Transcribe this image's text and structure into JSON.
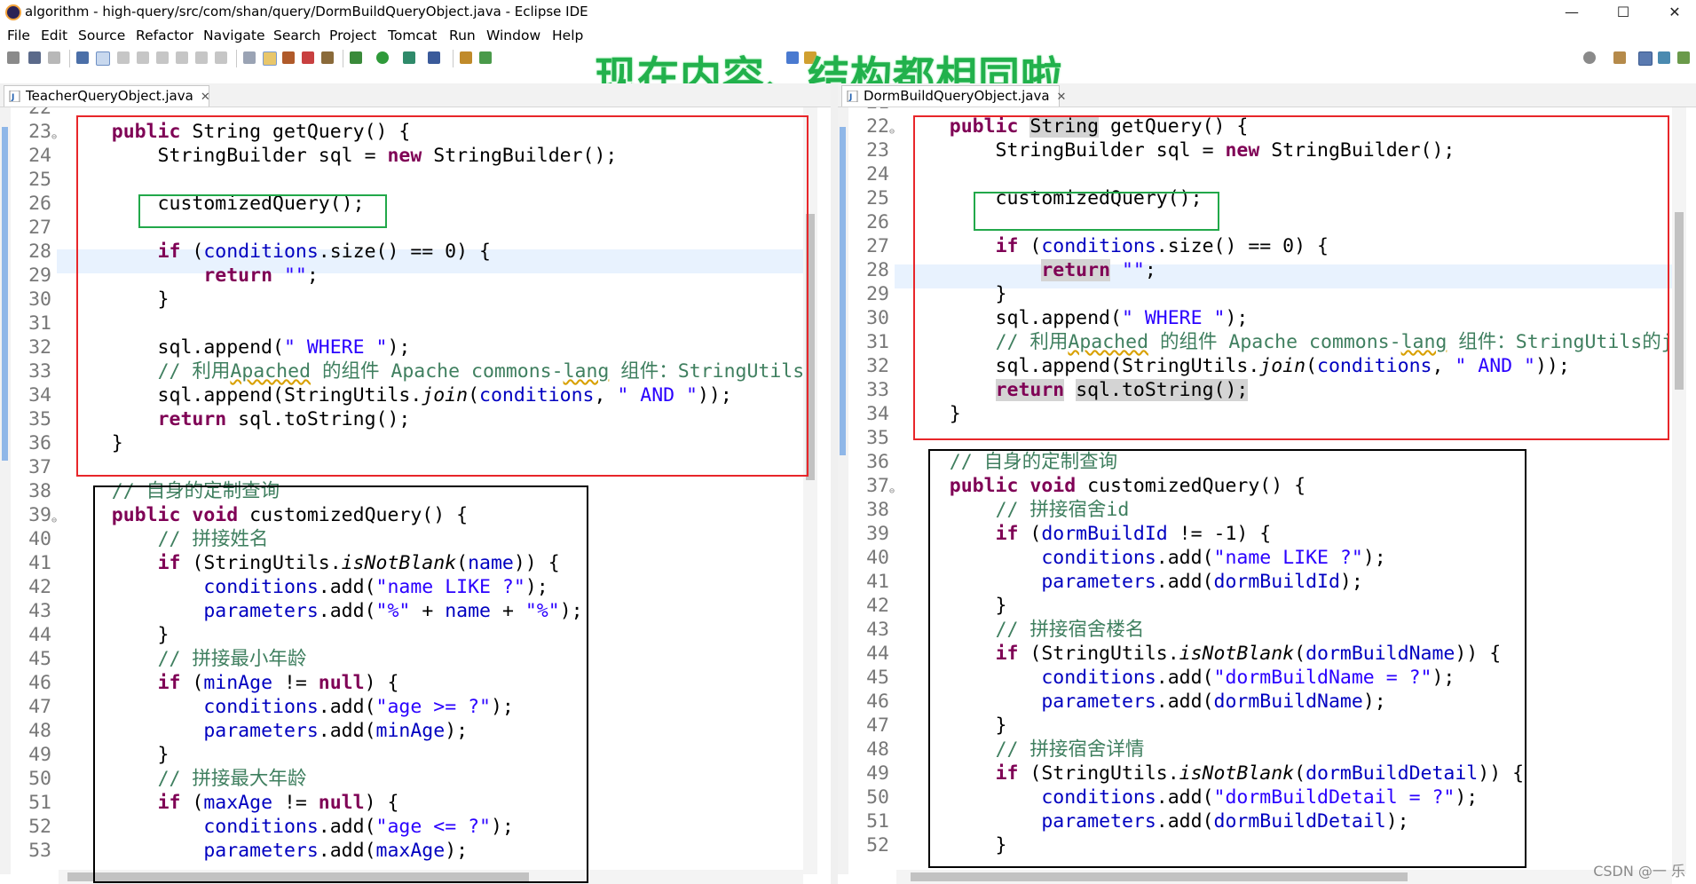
{
  "window": {
    "title": "algorithm - high-query/src/com/shan/query/DormBuildQueryObject.java - Eclipse IDE",
    "minimize": "—",
    "maximize": "☐",
    "close": "✕"
  },
  "menu": [
    "File",
    "Edit",
    "Source",
    "Refactor",
    "Navigate",
    "Search",
    "Project",
    "Tomcat",
    "Run",
    "Window",
    "Help"
  ],
  "overlay_text": "现在内容、结构都相同啦",
  "left": {
    "tab": "TeacherQueryObject.java",
    "lines": [
      {
        "n": "22",
        "t": []
      },
      {
        "n": "23",
        "fold": "⊖",
        "t": [
          [
            "    "
          ],
          [
            "public",
            "k"
          ],
          [
            " "
          ],
          [
            "String",
            "k0"
          ],
          [
            " getQuery() {"
          ]
        ]
      },
      {
        "n": "24",
        "t": [
          [
            "        StringBuilder "
          ],
          [
            "sql",
            ""
          ],
          [
            " = "
          ],
          [
            "new",
            "k"
          ],
          [
            " StringBuilder();"
          ]
        ]
      },
      {
        "n": "25",
        "t": []
      },
      {
        "n": "26",
        "t": [
          [
            "        customizedQuery();"
          ]
        ]
      },
      {
        "n": "27",
        "t": []
      },
      {
        "n": "28",
        "t": [
          [
            "        "
          ],
          [
            "if",
            "k"
          ],
          [
            " ("
          ],
          [
            "conditions",
            "f"
          ],
          [
            ".size() == 0) {"
          ]
        ]
      },
      {
        "n": "29",
        "t": [
          [
            "            "
          ],
          [
            "return",
            "k"
          ],
          [
            " "
          ],
          [
            "\"\"",
            "s"
          ],
          [
            ";"
          ]
        ]
      },
      {
        "n": "30",
        "t": [
          [
            "        }"
          ]
        ]
      },
      {
        "n": "31",
        "t": []
      },
      {
        "n": "32",
        "t": [
          [
            "        sql.append("
          ],
          [
            "\" WHERE \"",
            "s"
          ],
          [
            ");"
          ]
        ]
      },
      {
        "n": "33",
        "t": [
          [
            "        "
          ],
          [
            "// 利用",
            "c"
          ],
          [
            "Apached",
            "c squig"
          ],
          [
            " 的组件 Apache commons-",
            "c"
          ],
          [
            "lang",
            "c squig"
          ],
          [
            " 组件：StringUtils的j",
            "c"
          ]
        ]
      },
      {
        "n": "34",
        "t": [
          [
            "        sql.append(StringUtils."
          ],
          [
            "join",
            "i"
          ],
          [
            "("
          ],
          [
            "conditions",
            "f"
          ],
          [
            ", "
          ],
          [
            "\" AND \"",
            "s"
          ],
          [
            "));"
          ]
        ]
      },
      {
        "n": "35",
        "t": [
          [
            "        "
          ],
          [
            "return",
            "k"
          ],
          [
            " sql.toString();"
          ]
        ]
      },
      {
        "n": "36",
        "t": [
          [
            "    }"
          ]
        ]
      },
      {
        "n": "37",
        "t": []
      },
      {
        "n": "38",
        "t": [
          [
            "    "
          ],
          [
            "// 自身的定制查询",
            "c"
          ]
        ]
      },
      {
        "n": "39",
        "fold": "⊖",
        "t": [
          [
            "    "
          ],
          [
            "public",
            "k"
          ],
          [
            " "
          ],
          [
            "void",
            "k"
          ],
          [
            " customizedQuery() {"
          ]
        ]
      },
      {
        "n": "40",
        "t": [
          [
            "        "
          ],
          [
            "// 拼接姓名",
            "c"
          ]
        ]
      },
      {
        "n": "41",
        "t": [
          [
            "        "
          ],
          [
            "if",
            "k"
          ],
          [
            " (StringUtils."
          ],
          [
            "isNotBlank",
            "i"
          ],
          [
            "("
          ],
          [
            "name",
            "f"
          ],
          [
            ")) {"
          ]
        ]
      },
      {
        "n": "42",
        "t": [
          [
            "            "
          ],
          [
            "conditions",
            "f"
          ],
          [
            ".add("
          ],
          [
            "\"name LIKE ?\"",
            "s"
          ],
          [
            ");"
          ]
        ]
      },
      {
        "n": "43",
        "t": [
          [
            "            "
          ],
          [
            "parameters",
            "f"
          ],
          [
            ".add("
          ],
          [
            "\"%\"",
            "s"
          ],
          [
            " + "
          ],
          [
            "name",
            "f"
          ],
          [
            " + "
          ],
          [
            "\"%\"",
            "s"
          ],
          [
            ");"
          ]
        ]
      },
      {
        "n": "44",
        "t": [
          [
            "        }"
          ]
        ]
      },
      {
        "n": "45",
        "t": [
          [
            "        "
          ],
          [
            "// 拼接最小年龄",
            "c"
          ]
        ]
      },
      {
        "n": "46",
        "t": [
          [
            "        "
          ],
          [
            "if",
            "k"
          ],
          [
            " ("
          ],
          [
            "minAge",
            "f"
          ],
          [
            " != "
          ],
          [
            "null",
            "k"
          ],
          [
            ") {"
          ]
        ]
      },
      {
        "n": "47",
        "t": [
          [
            "            "
          ],
          [
            "conditions",
            "f"
          ],
          [
            ".add("
          ],
          [
            "\"age >= ?\"",
            "s"
          ],
          [
            ");"
          ]
        ]
      },
      {
        "n": "48",
        "t": [
          [
            "            "
          ],
          [
            "parameters",
            "f"
          ],
          [
            ".add("
          ],
          [
            "minAge",
            "f"
          ],
          [
            ");"
          ]
        ]
      },
      {
        "n": "49",
        "t": [
          [
            "        }"
          ]
        ]
      },
      {
        "n": "50",
        "t": [
          [
            "        "
          ],
          [
            "// 拼接最大年龄",
            "c"
          ]
        ]
      },
      {
        "n": "51",
        "t": [
          [
            "        "
          ],
          [
            "if",
            "k"
          ],
          [
            " ("
          ],
          [
            "maxAge",
            "f"
          ],
          [
            " != "
          ],
          [
            "null",
            "k"
          ],
          [
            ") {"
          ]
        ]
      },
      {
        "n": "52",
        "t": [
          [
            "            "
          ],
          [
            "conditions",
            "f"
          ],
          [
            ".add("
          ],
          [
            "\"age <= ?\"",
            "s"
          ],
          [
            ");"
          ]
        ]
      },
      {
        "n": "53",
        "t": [
          [
            "            "
          ],
          [
            "parameters",
            "f"
          ],
          [
            ".add("
          ],
          [
            "maxAge",
            "f"
          ],
          [
            ");"
          ]
        ]
      }
    ]
  },
  "right": {
    "tab": "DormBuildQueryObject.java",
    "lines": [
      {
        "n": "21",
        "t": []
      },
      {
        "n": "22",
        "fold": "⊖",
        "t": [
          [
            "    "
          ],
          [
            "public",
            "k"
          ],
          [
            " "
          ],
          [
            "String",
            "occ"
          ],
          [
            " getQuery() {"
          ]
        ]
      },
      {
        "n": "23",
        "t": [
          [
            "        StringBuilder "
          ],
          [
            "sql",
            ""
          ],
          [
            " = "
          ],
          [
            "new",
            "k"
          ],
          [
            " StringBuilder();"
          ]
        ]
      },
      {
        "n": "24",
        "t": []
      },
      {
        "n": "25",
        "t": [
          [
            "        customizedQuery();"
          ]
        ]
      },
      {
        "n": "26",
        "t": []
      },
      {
        "n": "27",
        "t": [
          [
            "        "
          ],
          [
            "if",
            "k"
          ],
          [
            " ("
          ],
          [
            "conditions",
            "f"
          ],
          [
            ".size() == 0) {"
          ]
        ]
      },
      {
        "n": "28",
        "t": [
          [
            "            "
          ],
          [
            "return",
            "k occ"
          ],
          [
            " "
          ],
          [
            "\"\"",
            "s"
          ],
          [
            ";"
          ]
        ]
      },
      {
        "n": "29",
        "t": [
          [
            "        }"
          ]
        ]
      },
      {
        "n": "30",
        "t": [
          [
            "        sql.append("
          ],
          [
            "\" WHERE \"",
            "s"
          ],
          [
            ");"
          ]
        ]
      },
      {
        "n": "31",
        "t": [
          [
            "        "
          ],
          [
            "// 利用",
            "c"
          ],
          [
            "Apached",
            "c squig"
          ],
          [
            " 的组件 Apache commons-",
            "c"
          ],
          [
            "lang",
            "c squig"
          ],
          [
            " 组件：StringUtils的join",
            "c"
          ]
        ]
      },
      {
        "n": "32",
        "t": [
          [
            "        sql.append(StringUtils."
          ],
          [
            "join",
            "i"
          ],
          [
            "("
          ],
          [
            "conditions",
            "f"
          ],
          [
            ", "
          ],
          [
            "\" AND \"",
            "s"
          ],
          [
            "));"
          ]
        ]
      },
      {
        "n": "33",
        "t": [
          [
            "        "
          ],
          [
            "return",
            "k occ"
          ],
          [
            " "
          ],
          [
            "sql.toString();",
            "occ"
          ]
        ]
      },
      {
        "n": "34",
        "t": [
          [
            "    }"
          ]
        ]
      },
      {
        "n": "35",
        "t": []
      },
      {
        "n": "36",
        "t": [
          [
            "    "
          ],
          [
            "// 自身的定制查询",
            "c"
          ]
        ]
      },
      {
        "n": "37",
        "fold": "⊖",
        "t": [
          [
            "    "
          ],
          [
            "public",
            "k"
          ],
          [
            " "
          ],
          [
            "void",
            "k"
          ],
          [
            " customizedQuery() {"
          ]
        ]
      },
      {
        "n": "38",
        "t": [
          [
            "        "
          ],
          [
            "// 拼接宿舍id",
            "c"
          ]
        ]
      },
      {
        "n": "39",
        "t": [
          [
            "        "
          ],
          [
            "if",
            "k"
          ],
          [
            " ("
          ],
          [
            "dormBuildId",
            "f"
          ],
          [
            " != -1) {"
          ]
        ]
      },
      {
        "n": "40",
        "t": [
          [
            "            "
          ],
          [
            "conditions",
            "f"
          ],
          [
            ".add("
          ],
          [
            "\"name LIKE ?\"",
            "s"
          ],
          [
            ");"
          ]
        ]
      },
      {
        "n": "41",
        "t": [
          [
            "            "
          ],
          [
            "parameters",
            "f"
          ],
          [
            ".add("
          ],
          [
            "dormBuildId",
            "f"
          ],
          [
            ");"
          ]
        ]
      },
      {
        "n": "42",
        "t": [
          [
            "        }"
          ]
        ]
      },
      {
        "n": "43",
        "t": [
          [
            "        "
          ],
          [
            "// 拼接宿舍楼名",
            "c"
          ]
        ]
      },
      {
        "n": "44",
        "t": [
          [
            "        "
          ],
          [
            "if",
            "k"
          ],
          [
            " (StringUtils."
          ],
          [
            "isNotBlank",
            "i"
          ],
          [
            "("
          ],
          [
            "dormBuildName",
            "f"
          ],
          [
            ")) {"
          ]
        ]
      },
      {
        "n": "45",
        "t": [
          [
            "            "
          ],
          [
            "conditions",
            "f"
          ],
          [
            ".add("
          ],
          [
            "\"dormBuildName = ?\"",
            "s"
          ],
          [
            ");"
          ]
        ]
      },
      {
        "n": "46",
        "t": [
          [
            "            "
          ],
          [
            "parameters",
            "f"
          ],
          [
            ".add("
          ],
          [
            "dormBuildName",
            "f"
          ],
          [
            ");"
          ]
        ]
      },
      {
        "n": "47",
        "t": [
          [
            "        }"
          ]
        ]
      },
      {
        "n": "48",
        "t": [
          [
            "        "
          ],
          [
            "// 拼接宿舍详情",
            "c"
          ]
        ]
      },
      {
        "n": "49",
        "t": [
          [
            "        "
          ],
          [
            "if",
            "k"
          ],
          [
            " (StringUtils."
          ],
          [
            "isNotBlank",
            "i"
          ],
          [
            "("
          ],
          [
            "dormBuildDetail",
            "f"
          ],
          [
            ")) {"
          ]
        ]
      },
      {
        "n": "50",
        "t": [
          [
            "            "
          ],
          [
            "conditions",
            "f"
          ],
          [
            ".add("
          ],
          [
            "\"dormBuildDetail = ?\"",
            "s"
          ],
          [
            ");"
          ]
        ]
      },
      {
        "n": "51",
        "t": [
          [
            "            "
          ],
          [
            "parameters",
            "f"
          ],
          [
            ".add("
          ],
          [
            "dormBuildDetail",
            "f"
          ],
          [
            ");"
          ]
        ]
      },
      {
        "n": "52",
        "t": [
          [
            "        }"
          ]
        ]
      }
    ]
  },
  "watermark": "CSDN @一 乐",
  "colors": {
    "red_box": "#e8262a",
    "green_box": "#22a84a",
    "black_box": "#000000",
    "overlay": "#22b14c"
  }
}
